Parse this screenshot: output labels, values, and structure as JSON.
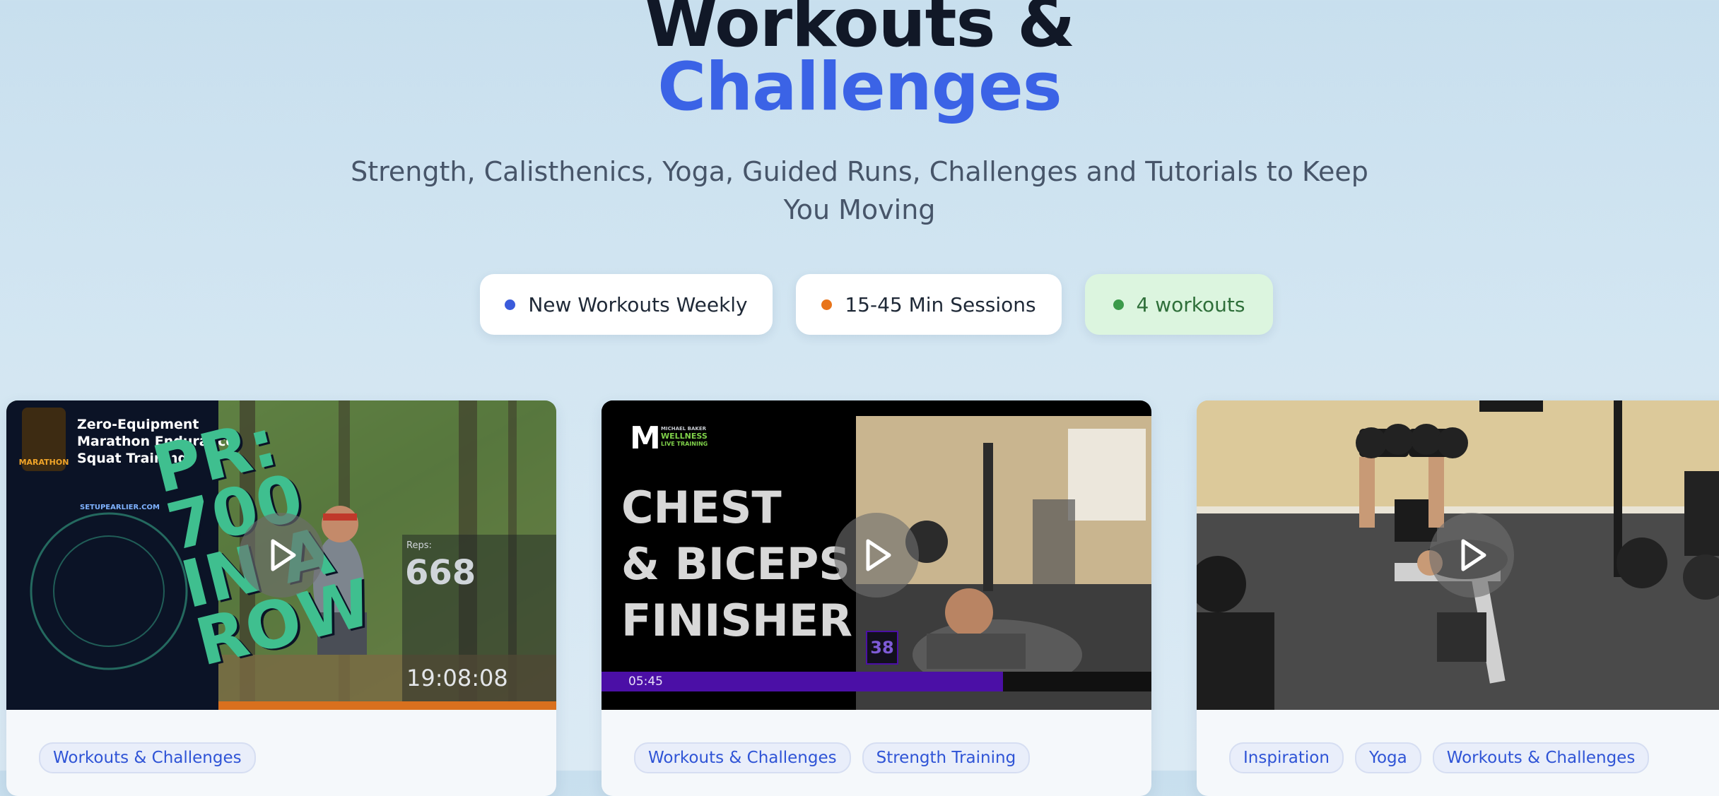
{
  "hero": {
    "title_line1": "Workouts &",
    "title_line2": "Challenges",
    "subtitle": "Strength, Calisthenics, Yoga, Guided Runs, Challenges and Tutorials to Keep You Moving"
  },
  "pills": [
    {
      "label": "New Workouts Weekly",
      "dot_color": "#3b5bdb"
    },
    {
      "label": "15-45 Min Sessions",
      "dot_color": "#e8741a"
    },
    {
      "label": "4 workouts",
      "dot_color": "#3b9a4a"
    }
  ],
  "cards": [
    {
      "overlay": {
        "badge": "MARATHON",
        "heading": "Zero-Equipment Marathon Endurance Squat Training",
        "site": "SETUPEARLIER.COM",
        "big_text": "PR: 700 IN A ROW",
        "reps_label": "Reps:",
        "reps_value": "668",
        "timer": "19:08:08"
      },
      "tags": [
        "Workouts & Challenges"
      ]
    },
    {
      "overlay": {
        "logo_mark": "M",
        "logo_line1": "MICHAEL BAKER",
        "logo_line2": "WELLNESS",
        "logo_line3": "LIVE TRAINING",
        "heading_line1": "CHEST",
        "heading_line2": "& BICEPS",
        "heading_line3": "FINISHER",
        "counter": "38",
        "progress_time": "05:45",
        "progress_fraction": 0.73
      },
      "tags": [
        "Workouts & Challenges",
        "Strength Training"
      ]
    },
    {
      "overlay": {},
      "tags": [
        "Inspiration",
        "Yoga",
        "Workouts & Challenges"
      ]
    }
  ],
  "colors": {
    "accent": "#3b63e6",
    "title_dark": "#111827",
    "tag_text": "#2f54d6",
    "progress_purple": "#4b0fa6",
    "neon_green": "#3fbf8f"
  },
  "icons": {
    "play": "play-icon"
  }
}
